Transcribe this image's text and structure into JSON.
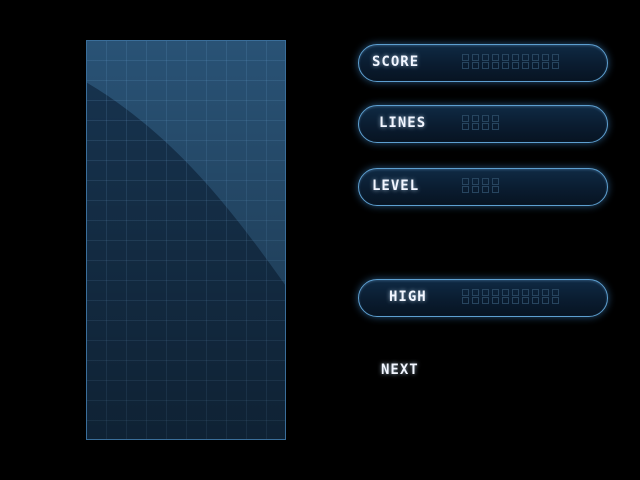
{
  "hud": {
    "score": {
      "label": "SCORE",
      "digits": 10
    },
    "lines": {
      "label": "LINES",
      "digits": 4
    },
    "level": {
      "label": "LEVEL",
      "digits": 4
    },
    "high": {
      "label": "HIGH",
      "digits": 10
    },
    "next": {
      "label": "NEXT"
    }
  },
  "colors": {
    "background": "#000000",
    "playfield": "#173450",
    "panel_border": "#5d9fd0",
    "label_text": "#f2f6ff"
  }
}
